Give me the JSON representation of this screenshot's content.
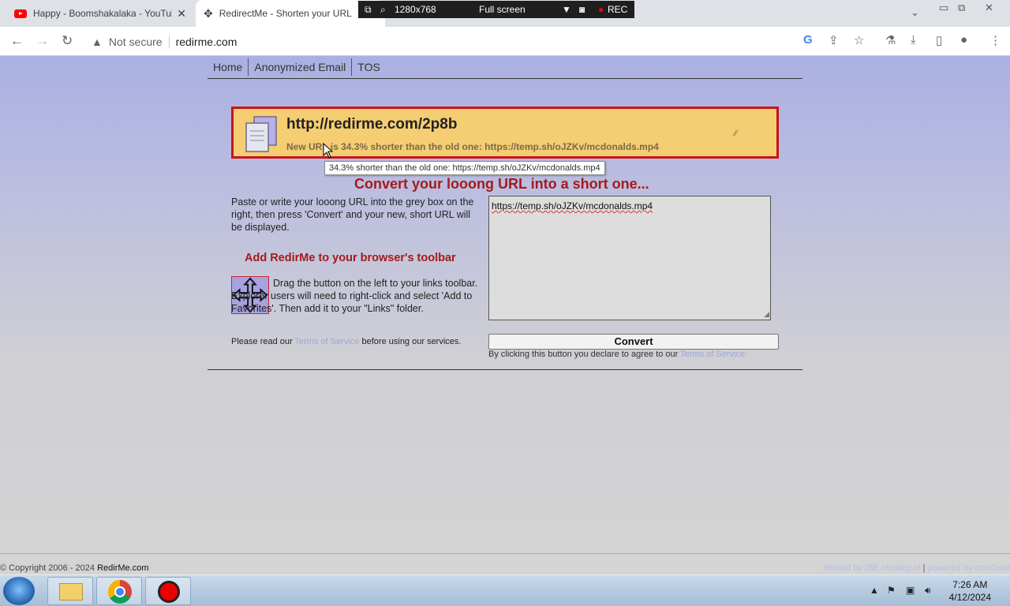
{
  "browser": {
    "tabs": [
      {
        "title": "Happy - Boomshakalaka - YouTube",
        "icon": "youtube-icon"
      },
      {
        "title": "RedirectMe - Shorten your URL",
        "icon": "move-arrows-icon"
      }
    ],
    "recorder": {
      "resolution": "1280x768",
      "mode": "Full screen",
      "rec_label": "REC"
    },
    "security_label": "Not secure",
    "url": "redirme.com"
  },
  "nav": {
    "items": [
      "Home",
      "Anonymized Email",
      "TOS"
    ]
  },
  "result": {
    "short_url": "http://redirme.com/2p8b",
    "note": "New URL is 34.3% shorter than the old one: https://temp.sh/oJZKv/mcdonalds.mp4",
    "tooltip": "34.3% shorter than the old one: https://temp.sh/oJZKv/mcdonalds.mp4"
  },
  "main": {
    "heading": "Convert your looong URL into a short one...",
    "intro": "Paste or write your looong URL into the grey box on the right, then press 'Convert' and your new, short URL will be displayed.",
    "toolbar_heading": "Add RedirMe to your browser's toolbar",
    "drag_text": "Drag the button on the left to your links toolbar. Explorer users will need to right-click and select 'Add to Favorites'. Then add it to your \"Links\" folder.",
    "tos_prefix": "Please read our ",
    "tos_link": "Terms of Service",
    "tos_suffix": " before using our services.",
    "url_value": "https://temp.sh/oJZKv/mcdonalds.mp4",
    "convert_label": "Convert",
    "agree_prefix": "By clicking this button you declare to agree to our ",
    "agree_link": "Terms of Service"
  },
  "footer": {
    "copyright_prefix": "© Copyright 2006 - 2024 ",
    "site": "RedirMe.com",
    "hosted": "Hosted by IBE-Hosting.nl",
    "sep": " | ",
    "powered": "powered by cmsGear"
  },
  "taskbar": {
    "time": "7:26 AM",
    "date": "4/12/2024"
  },
  "colors": {
    "accent_red": "#c8151b",
    "result_bg": "#f5cd72",
    "heading_red": "#a51a1a",
    "page_bg_top": "#aab0e2"
  }
}
